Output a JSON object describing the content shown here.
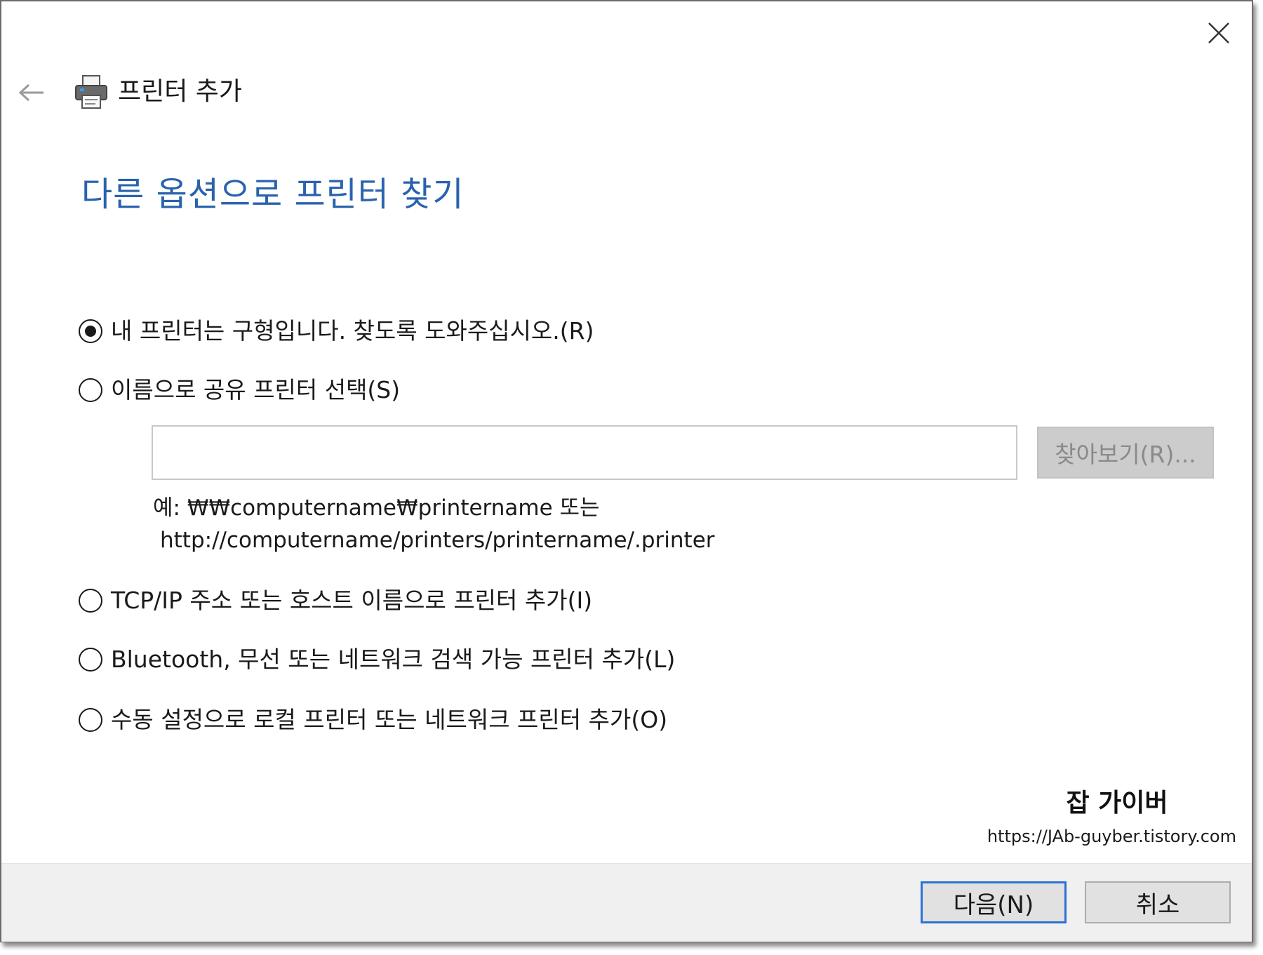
{
  "window": {
    "title": "프린터 추가",
    "close_icon": "close-icon",
    "back_icon": "back-arrow-icon",
    "title_icon": "printer-icon"
  },
  "heading": "다른 옵션으로 프린터 찾기",
  "options": [
    {
      "label": "내 프린터는 구형입니다. 찾도록 도와주십시오.(R)",
      "checked": true
    },
    {
      "label": "이름으로 공유 프린터 선택(S)",
      "checked": false
    },
    {
      "label": "TCP/IP 주소 또는 호스트 이름으로 프린터 추가(I)",
      "checked": false
    },
    {
      "label": "Bluetooth, 무선 또는 네트워크 검색 가능 프린터 추가(L)",
      "checked": false
    },
    {
      "label": "수동 설정으로 로컬 프린터 또는 네트워크 프린터 추가(O)",
      "checked": false
    }
  ],
  "shared_printer": {
    "value": "",
    "browse_label": "찾아보기(R)...",
    "hint_line1": "예: ₩₩computername₩printername 또는",
    "hint_line2": "http://computername/printers/printername/.printer"
  },
  "watermark": {
    "title": "잡 가이버",
    "url": "https://JAb-guyber.tistory.com"
  },
  "footer": {
    "next_label": "다음(N)",
    "cancel_label": "취소"
  },
  "colors": {
    "heading": "#2a62ad",
    "next_border": "#2b72d4",
    "footer_bg": "#f0f0f0"
  }
}
